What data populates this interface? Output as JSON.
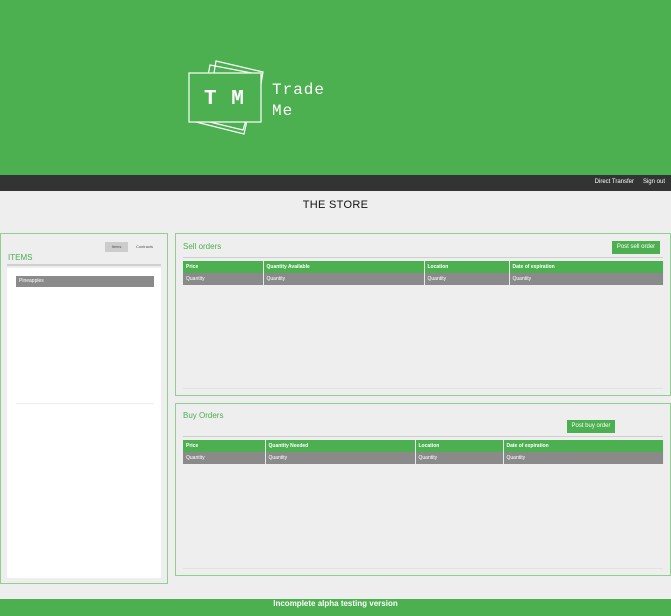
{
  "brand": {
    "mark": "T M",
    "name_line1": "Trade",
    "name_line2": "Me"
  },
  "nav": {
    "direct_transfer": "Direct Transfer",
    "sign_out": "Sign out"
  },
  "page": {
    "title": "THE STORE"
  },
  "items_panel": {
    "tab_items": "Items",
    "tab_contracts": "Contracts",
    "heading": "ITEMS",
    "items": [
      "Pineapples"
    ]
  },
  "sell_orders": {
    "title": "Sell orders",
    "post_button": "Post sell order",
    "columns": [
      "Price",
      "Quantity Available",
      "Location",
      "Date of expiration"
    ],
    "rows": [
      [
        "Quantity",
        "Quantity",
        "Quantity",
        "Quantity"
      ]
    ]
  },
  "buy_orders": {
    "title": "Buy Orders",
    "post_button": "Post buy order",
    "columns": [
      "Price",
      "Quantity Needed",
      "Location",
      "Date of expiration"
    ],
    "rows": [
      [
        "Quantity",
        "Quantity",
        "Quantity",
        "Quantity"
      ]
    ]
  },
  "footer": {
    "text": "Incomplete alpha testing version"
  },
  "colors": {
    "brand_green": "#4caf50",
    "navbar": "#333333",
    "row_gray": "#8a8a8a"
  }
}
